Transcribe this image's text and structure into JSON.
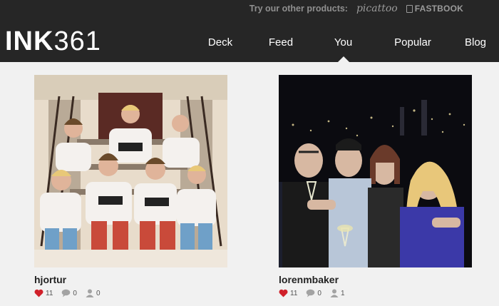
{
  "header": {
    "promo_text": "Try our other products:",
    "products": [
      {
        "label": "picattoo"
      },
      {
        "label": "FASTBOOK"
      }
    ],
    "logo_bold": "INK",
    "logo_light": "361",
    "nav": [
      {
        "label": "Deck"
      },
      {
        "label": "Feed"
      },
      {
        "label": "You",
        "active": true
      },
      {
        "label": "Popular"
      },
      {
        "label": "Blog"
      }
    ]
  },
  "posts": [
    {
      "username": "hjortur",
      "likes": "11",
      "comments": "0",
      "followers": "0"
    },
    {
      "username": "lorenmbaker",
      "likes": "11",
      "comments": "0",
      "followers": "1"
    }
  ],
  "colors": {
    "topbar": "#262626",
    "like": "#d0202a",
    "icon_gray": "#a3a3a3",
    "page_bg": "#f1f1f1"
  }
}
